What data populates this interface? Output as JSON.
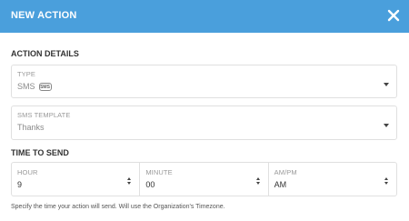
{
  "modal": {
    "title": "NEW ACTION",
    "close_icon": "close-icon"
  },
  "action_details": {
    "heading": "ACTION DETAILS",
    "type": {
      "label": "TYPE",
      "value": "SMS",
      "icon_text": "SMS"
    },
    "sms_template": {
      "label": "SMS TEMPLATE",
      "value": "Thanks"
    }
  },
  "time_to_send": {
    "heading": "TIME TO SEND",
    "hour": {
      "label": "HOUR",
      "value": "9"
    },
    "minute": {
      "label": "MINUTE",
      "value": "00"
    },
    "ampm": {
      "label": "AM/PM",
      "value": "AM"
    },
    "helper": "Specify the time your action will send. Will use the Organization's Timezone."
  },
  "colors": {
    "header_bg": "#4a9fdc",
    "header_text": "#ffffff"
  }
}
